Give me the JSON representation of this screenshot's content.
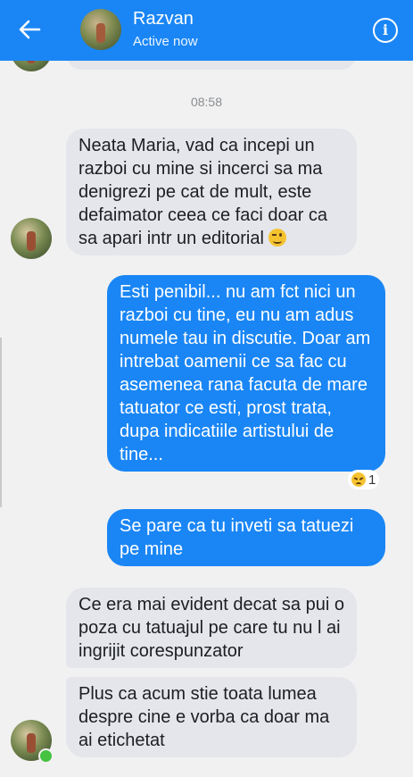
{
  "header": {
    "name": "Razvan",
    "status": "Active now"
  },
  "timestamp": "08:58",
  "messages": [
    {
      "from": "other",
      "text": "Neata Maria, vad ca incepi un razboi cu mine si incerci sa ma denigrezi pe cat de mult, este defaimator ceea ce faci doar ca sa apari intr un editorial",
      "emoji": "wink-emoji"
    },
    {
      "from": "me",
      "text": "Esti penibil... nu am fct nici un razboi cu tine, eu nu am adus numele tau in discutie. Doar am intrebat oamenii ce sa fac cu asemenea rana facuta de mare tatuator ce esti, prost trata, dupa indicatiile artistului de tine..."
    },
    {
      "from": "me",
      "text": "Se pare ca tu inveti sa tatuezi pe mine"
    },
    {
      "from": "other",
      "text": "Ce era mai evident decat sa pui o poza cu tatuajul pe care tu nu l ai ingrijit corespunzator"
    },
    {
      "from": "other",
      "text": "Plus ca acum stie toata lumea despre cine e vorba ca doar ma ai etichetat"
    }
  ],
  "reaction": {
    "icon": "angry-face-icon",
    "count": "1"
  },
  "colors": {
    "accent": "#1a86f5",
    "received_bubble": "#e4e6eb",
    "background": "#f1f1f1"
  }
}
